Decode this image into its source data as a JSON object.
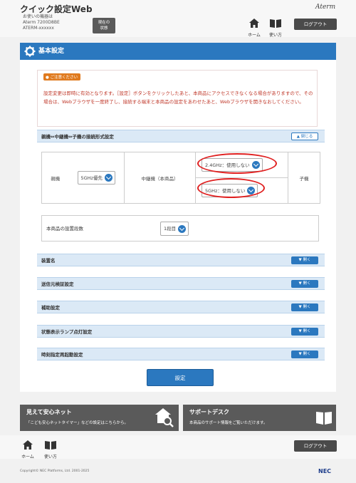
{
  "header": {
    "app_title": "クイック設定Web",
    "device_lines": [
      "お使いの機器は",
      "Aterm 7200D8BE",
      "ATERM-xxxxxx"
    ],
    "status_button": [
      "現在の",
      "状態"
    ],
    "brand": "Aterm",
    "home_label": "ホーム",
    "help_label": "使い方",
    "logout_label": "ログアウト"
  },
  "page": {
    "section_title": "基本設定",
    "notice_badge": "ご注意ください",
    "notice_text": "設定変更は即時に有効となります。［設定］ボタンをクリックしたあと、本商品にアクセスできなくなる場合がありますので、その場合は、Webブラウザを一度終了し、接続する端末と本商品の設定をあわせたあと、Webブラウザを開きなおしてください。"
  },
  "connection": {
    "title": "親機⇔中継機⇔子機の接続形式設定",
    "toggle_label": "閉じる",
    "parent_label": "親機",
    "parent_select": "5GHz優先",
    "repeater_label": "中継機（本商品）",
    "band24_select": "2.4GHz：使用しない",
    "band5_select": "5GHz：使用しない",
    "child_label": "子機"
  },
  "depth": {
    "label": "本商品の設置段数",
    "value": "1段目"
  },
  "sections": [
    {
      "title": "装置名",
      "button": "開く"
    },
    {
      "title": "送信元検証設定",
      "button": "開く"
    },
    {
      "title": "補助設定",
      "button": "開く"
    },
    {
      "title": "状態表示ランプ点灯設定",
      "button": "開く"
    },
    {
      "title": "時刻指定再起動設定",
      "button": "開く"
    }
  ],
  "submit_label": "設定",
  "banners": {
    "left_title": "見えて安心ネット",
    "left_sub": "「こども安心ネットタイマー」などの設定はこちらから。",
    "right_title": "サポートデスク",
    "right_sub": "本商品のサポート情報をご覧いただけます。"
  },
  "footer": {
    "home_label": "ホーム",
    "help_label": "使い方",
    "logout_label": "ログアウト",
    "copyright": "Copyright© NEC Platforms, Ltd. 2001-2025",
    "nec": "NEC"
  },
  "colors": {
    "accent": "#2b78bf",
    "notice_text": "#c0392b",
    "badge": "#e07a1e",
    "highlight_oval": "#e02020",
    "dark_button": "#4a4a4a"
  },
  "icons": [
    "home-icon",
    "book-icon",
    "gear-icon",
    "chevron-down-icon",
    "chevron-up-icon",
    "house-search-icon"
  ]
}
